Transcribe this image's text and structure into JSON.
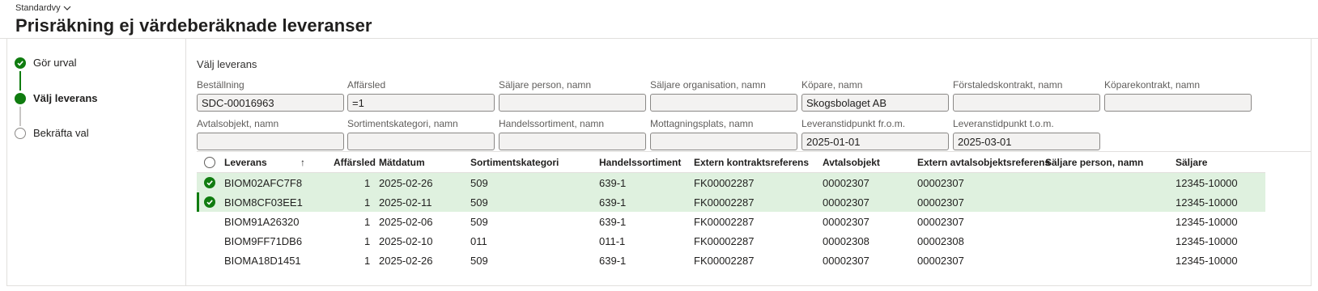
{
  "header": {
    "view_label": "Standardvy",
    "title": "Prisräkning ej värdeberäknade leveranser"
  },
  "steps": [
    {
      "label": "Gör urval",
      "state": "done"
    },
    {
      "label": "Välj leverans",
      "state": "current"
    },
    {
      "label": "Bekräfta val",
      "state": "todo"
    }
  ],
  "section": {
    "title": "Välj leverans"
  },
  "filters": {
    "bestallning": {
      "label": "Beställning",
      "value": "SDC-00016963"
    },
    "affarsled": {
      "label": "Affärsled",
      "value": "=1"
    },
    "saljare_person": {
      "label": "Säljare person, namn",
      "value": ""
    },
    "saljare_org": {
      "label": "Säljare organisation, namn",
      "value": ""
    },
    "kopare": {
      "label": "Köpare, namn",
      "value": "Skogsbolaget AB"
    },
    "forstaledskontrakt": {
      "label": "Förstaledskontrakt, namn",
      "value": ""
    },
    "koparekontrakt": {
      "label": "Köparekontrakt, namn",
      "value": ""
    },
    "avtalsobjekt": {
      "label": "Avtalsobjekt, namn",
      "value": ""
    },
    "sortimentskategori": {
      "label": "Sortimentskategori, namn",
      "value": ""
    },
    "handelssortiment": {
      "label": "Handelssortiment, namn",
      "value": ""
    },
    "mottagningsplats": {
      "label": "Mottagningsplats, namn",
      "value": ""
    },
    "leveranstid_from": {
      "label": "Leveranstidpunkt fr.o.m.",
      "value": "2025-01-01"
    },
    "leveranstid_tom": {
      "label": "Leveranstidpunkt t.o.m.",
      "value": "2025-03-01"
    }
  },
  "grid": {
    "sort_indicator": "↑",
    "columns": {
      "leverans": "Leverans",
      "affarsled": "Affärsled",
      "matdatum": "Mätdatum",
      "sortimentskategori": "Sortimentskategori",
      "handelssortiment": "Handelssortiment",
      "extern_kontrakt": "Extern kontraktsreferens",
      "avtalsobjekt": "Avtalsobjekt",
      "extern_avtal": "Extern avtalsobjektsreferens",
      "saljare_person": "Säljare person, namn",
      "saljare": "Säljare"
    },
    "rows": [
      {
        "leverans": "BIOM02AFC7F8",
        "affarsled": "1",
        "matdatum": "2025-02-26",
        "sortimentskategori": "509",
        "handelssortiment": "639-1",
        "extern_kontrakt": "FK00002287",
        "avtalsobjekt": "00002307",
        "extern_avtal": "00002307",
        "saljare_person": "",
        "saljare": "12345-10000",
        "selected": true
      },
      {
        "leverans": "BIOM8CF03EE1",
        "affarsled": "1",
        "matdatum": "2025-02-11",
        "sortimentskategori": "509",
        "handelssortiment": "639-1",
        "extern_kontrakt": "FK00002287",
        "avtalsobjekt": "00002307",
        "extern_avtal": "00002307",
        "saljare_person": "",
        "saljare": "12345-10000",
        "selected": true
      },
      {
        "leverans": "BIOM91A26320",
        "affarsled": "1",
        "matdatum": "2025-02-06",
        "sortimentskategori": "509",
        "handelssortiment": "639-1",
        "extern_kontrakt": "FK00002287",
        "avtalsobjekt": "00002307",
        "extern_avtal": "00002307",
        "saljare_person": "",
        "saljare": "12345-10000",
        "selected": false
      },
      {
        "leverans": "BIOM9FF71DB6",
        "affarsled": "1",
        "matdatum": "2025-02-10",
        "sortimentskategori": "011",
        "handelssortiment": "011-1",
        "extern_kontrakt": "FK00002287",
        "avtalsobjekt": "00002308",
        "extern_avtal": "00002308",
        "saljare_person": "",
        "saljare": "12345-10000",
        "selected": false
      },
      {
        "leverans": "BIOMA18D1451",
        "affarsled": "1",
        "matdatum": "2025-02-26",
        "sortimentskategori": "509",
        "handelssortiment": "639-1",
        "extern_kontrakt": "FK00002287",
        "avtalsobjekt": "00002307",
        "extern_avtal": "00002307",
        "saljare_person": "",
        "saljare": "12345-10000",
        "selected": false
      }
    ]
  },
  "colors": {
    "accent": "#107c10",
    "selected_row": "#dff1df"
  }
}
